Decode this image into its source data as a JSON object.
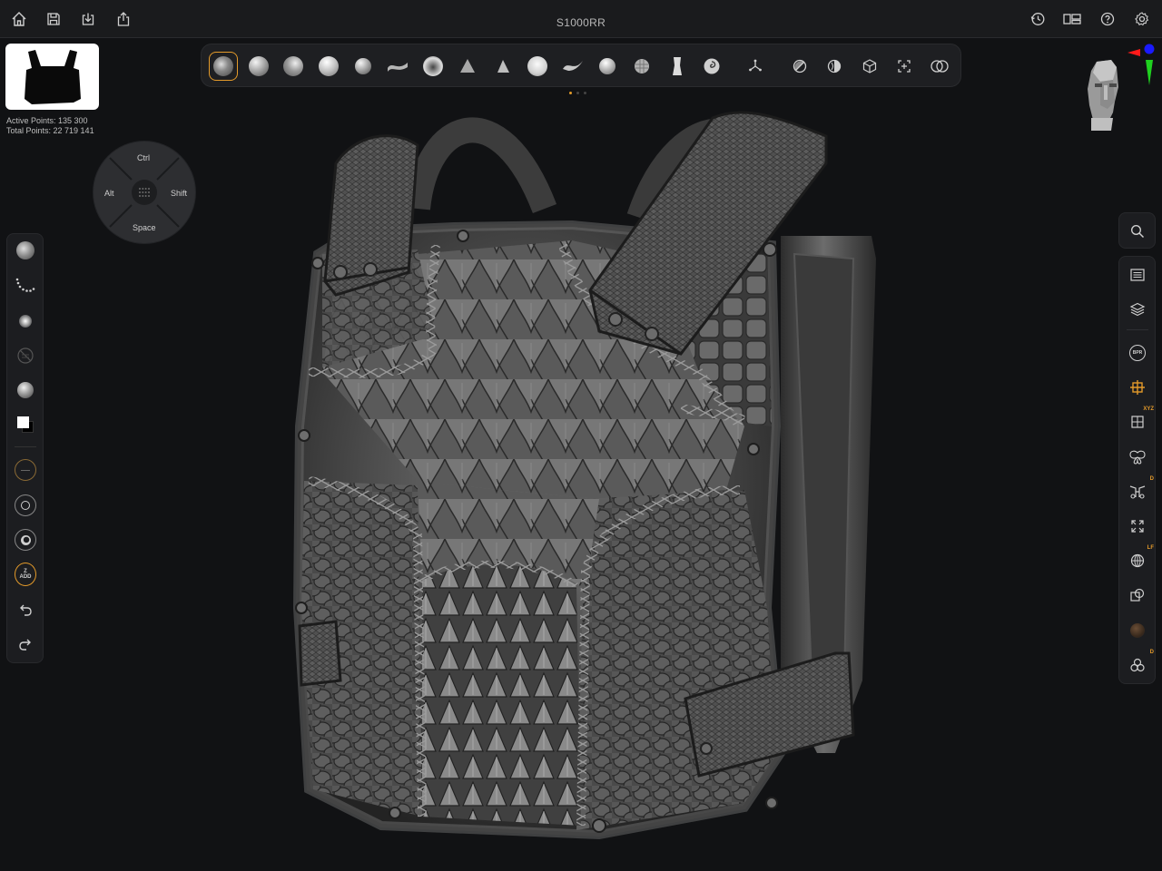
{
  "app": {
    "document_title": "S1000RR"
  },
  "topbar": {
    "left_icons": [
      "home-icon",
      "save-icon",
      "import-icon",
      "share-icon"
    ],
    "right_icons": [
      "history-icon",
      "layout-icon",
      "help-icon",
      "settings-icon"
    ]
  },
  "stats": {
    "active_points": "Active Points: 135 300",
    "total_points": "Total Points: 22 719 141"
  },
  "modifiers": {
    "top": "Ctrl",
    "left": "Alt",
    "right": "Shift",
    "bottom": "Space"
  },
  "brushbar": {
    "brushes": [
      "clay-buildup",
      "standard",
      "move",
      "smooth",
      "inflate",
      "dam-standard",
      "crease",
      "pinch",
      "trim-dynamic",
      "flatten",
      "snakehook",
      "polish",
      "hpolish",
      "mask-pen",
      "curve"
    ],
    "tools": [
      "gizmo-icon",
      "dynamesh-icon",
      "zremesher-icon",
      "primitive-icon",
      "frame-icon",
      "boolean-icon"
    ],
    "page_dots": 3,
    "active_page": 1,
    "active_brush": "clay-buildup"
  },
  "lefttools": [
    "brush-icon",
    "stroke-icon",
    "alpha-icon",
    "texture-off-icon",
    "material-icon",
    "color-swatch-icon",
    "draw-size-icon",
    "focal-shift-icon",
    "intensity-icon",
    "zadd-icon",
    "undo-icon",
    "redo-icon"
  ],
  "zadd_top": "Z",
  "zadd_bottom": "ADD",
  "rightpanel_top": [
    "search-icon"
  ],
  "rightpanel_main": [
    "subtool-list-icon",
    "layers-icon",
    "bpr-icon",
    "transform-icon",
    "xyz-symmetry-icon",
    "mirror-icon",
    "dynamic-symmetry-icon",
    "fit-view-icon",
    "perspective-icon",
    "local-icon",
    "floor-icon",
    "polyframe-icon"
  ],
  "right_badges": {
    "xyz": "XYZ",
    "dyn": "D",
    "persp": "LF",
    "poly": "D"
  },
  "bpr_label": "BPR",
  "colors": {
    "accent": "#e39a2a",
    "bg": "#111214",
    "panel": "#1c1d20"
  }
}
